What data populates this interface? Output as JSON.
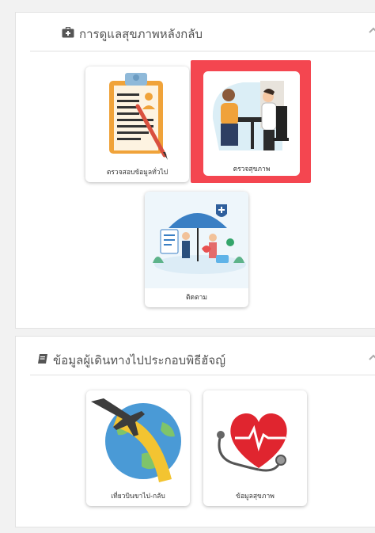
{
  "sections": [
    {
      "title": "การดูแลสุขภาพหลังกลับ",
      "icon": "medical-kit-icon",
      "caret": "^",
      "cards": [
        {
          "label": "ตรวจสอบข้อมูลทั่วไป",
          "icon": "clipboard-checklist-icon"
        },
        {
          "label": "ตรวจสุขภาพ",
          "icon": "doctor-consultation-icon",
          "selected": true
        },
        {
          "label": "ติดตาม",
          "icon": "health-umbrella-icon"
        }
      ]
    },
    {
      "title": "ข้อมูลผู้เดินทางไปประกอบพิธีฮัจญ์",
      "icon": "book-icon",
      "caret": "^",
      "cards": [
        {
          "label": "เที่ยวบินขาไป-กลับ",
          "icon": "airplane-globe-icon"
        },
        {
          "label": "ข้อมูลสุขภาพ",
          "icon": "heart-stethoscope-icon"
        }
      ]
    }
  ],
  "colors": {
    "highlight": "#f44650",
    "accent_blue": "#4a90d9",
    "heart_red": "#e0252f"
  }
}
